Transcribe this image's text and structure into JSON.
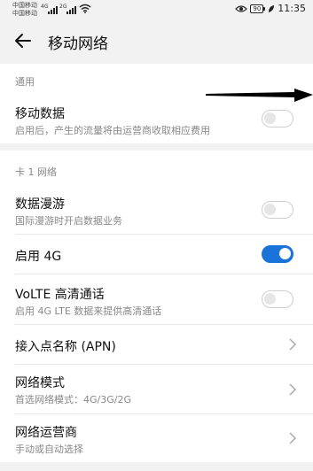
{
  "status_bar": {
    "carrier1": "中国移动",
    "carrier2": "中国移动",
    "sim1_network": "4G",
    "sim2_network": "2G",
    "battery": "90",
    "time": "11:35"
  },
  "title_bar": {
    "title": "移动网络"
  },
  "general": {
    "header": "通用",
    "mobile_data": {
      "title": "移动数据",
      "subtitle": "启用后，产生的流量将由运营商收取相应费用",
      "enabled": false
    }
  },
  "card1": {
    "header": "卡 1 网络",
    "roaming": {
      "title": "数据漫游",
      "subtitle": "国际漫游时开启数据业务",
      "enabled": false
    },
    "enable_4g": {
      "title": "启用 4G",
      "enabled": true
    },
    "volte": {
      "title": "VoLTE 高清通话",
      "subtitle": "启用 4G LTE 数据来提供高清通话",
      "enabled": false
    },
    "apn": {
      "title": "接入点名称 (APN)"
    },
    "network_mode": {
      "title": "网络模式",
      "subtitle": "首选网络模式：4G/3G/2G"
    },
    "operator": {
      "title": "网络运营商",
      "subtitle": "手动或自动选择"
    }
  },
  "colors": {
    "accent": "#1a73d9",
    "background": "#f2f2f2",
    "card": "#ffffff",
    "secondary_text": "#888888"
  }
}
